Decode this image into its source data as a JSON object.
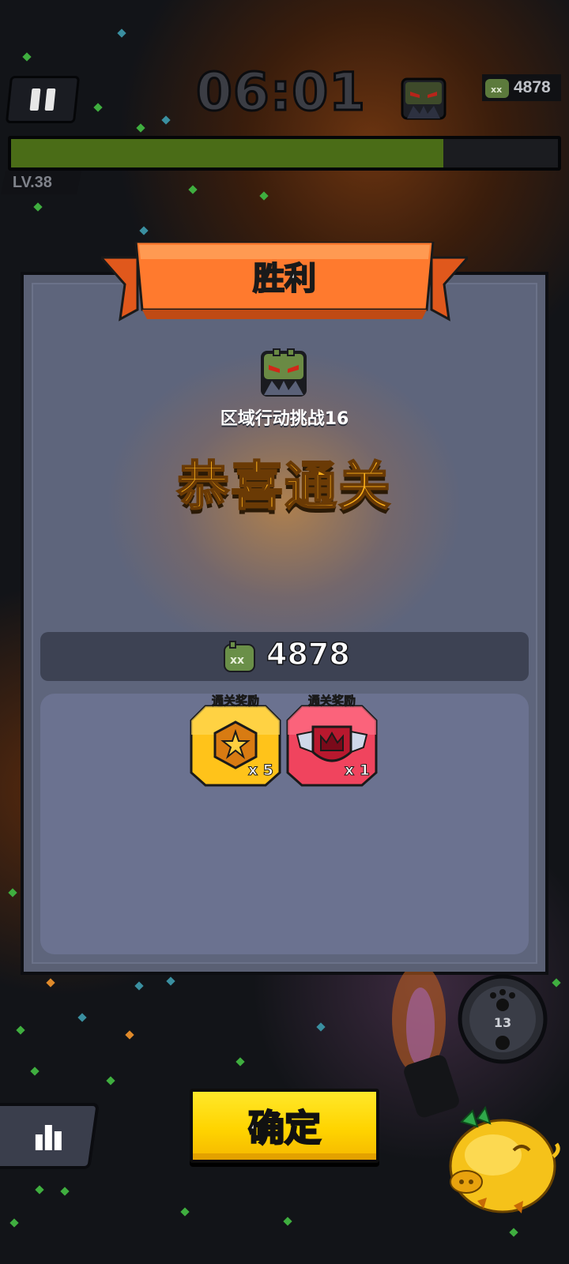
{
  "hud": {
    "timer": "06:01",
    "kill_count": "4878",
    "level": "LV.38",
    "xp_progress": 0.79
  },
  "victory": {
    "banner_title": "胜利",
    "stage_name": "区域行动挑战16",
    "message": "恭喜通关",
    "kills": "4878",
    "rewards": [
      {
        "label": "通关奖励",
        "icon": "star-hexagon-icon",
        "quantity": "x 5",
        "color": "#ffc31a"
      },
      {
        "label": "通关奖励",
        "icon": "crown-shield-icon",
        "quantity": "x 1",
        "color": "#f0445e"
      }
    ]
  },
  "buttons": {
    "confirm": "确定"
  },
  "skill": {
    "charges": "13"
  },
  "colors": {
    "banner": "#ff7a2e",
    "confirm": "#ffd400",
    "message": "#ffb21a",
    "panel": "#5e657c",
    "xp_fill": "#4a6c17"
  }
}
